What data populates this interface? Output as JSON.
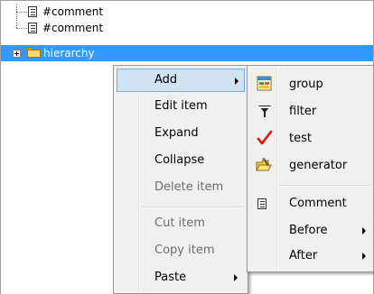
{
  "tree": {
    "items": [
      {
        "label": "#comment"
      },
      {
        "label": "#comment"
      },
      {
        "label": "hierarchy"
      }
    ]
  },
  "context_menu": {
    "items": [
      {
        "label": "Add",
        "enabled": true,
        "submenu": true,
        "highlighted": true
      },
      {
        "label": "Edit item",
        "enabled": true
      },
      {
        "label": "Expand",
        "enabled": true
      },
      {
        "label": "Collapse",
        "enabled": true
      },
      {
        "label": "Delete item",
        "enabled": false
      },
      {
        "label": "Cut item",
        "enabled": false
      },
      {
        "label": "Copy item",
        "enabled": false
      },
      {
        "label": "Paste",
        "enabled": true,
        "submenu": true
      }
    ]
  },
  "add_submenu": {
    "items": [
      {
        "label": "group",
        "icon": "group-icon"
      },
      {
        "label": "filter",
        "icon": "filter-icon"
      },
      {
        "label": "test",
        "icon": "checkmark-icon"
      },
      {
        "label": "generator",
        "icon": "generator-icon"
      },
      {
        "label": "Comment",
        "icon": "document-icon"
      },
      {
        "label": "Before",
        "submenu": true
      },
      {
        "label": "After",
        "submenu": true
      }
    ]
  },
  "colors": {
    "selection": "#3399ff",
    "menu_background": "#f0f0f0",
    "menu_highlight": "#d1e2f2",
    "check": "#e01010"
  }
}
